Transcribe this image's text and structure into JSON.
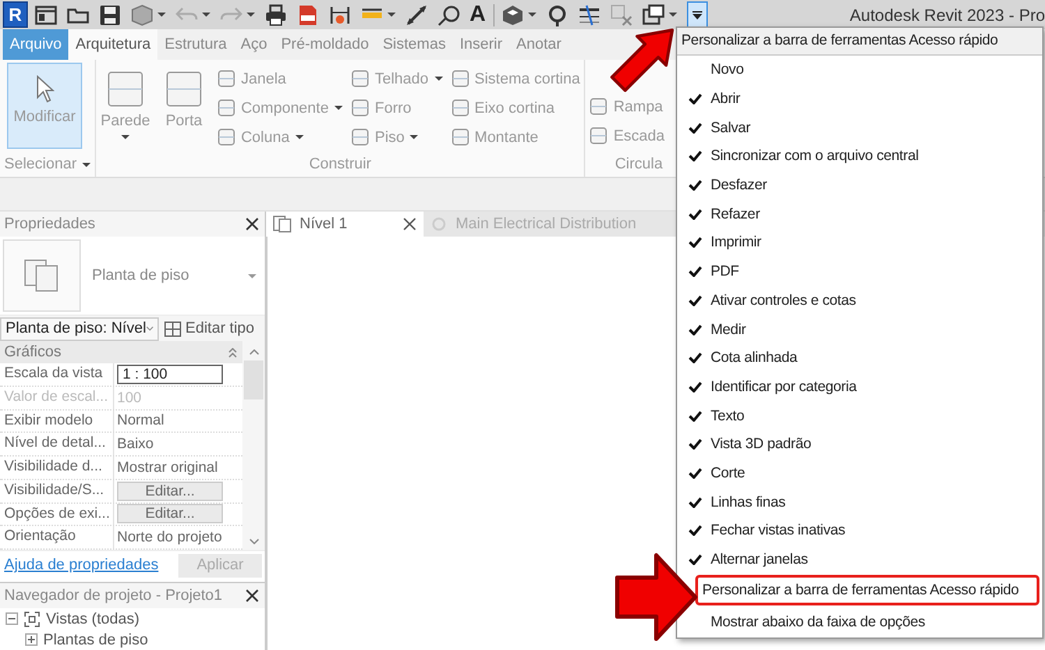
{
  "window": {
    "title": "Autodesk Revit 2023 - Pro"
  },
  "quick_access": {
    "logo": "R",
    "text_tool": "A"
  },
  "ribbon": {
    "tabs": [
      {
        "label": "Arquivo",
        "kind": "file",
        "selected": false
      },
      {
        "label": "Arquitetura",
        "kind": "tab",
        "selected": true
      },
      {
        "label": "Estrutura",
        "kind": "tab",
        "selected": false
      },
      {
        "label": "Aço",
        "kind": "tab",
        "selected": false
      },
      {
        "label": "Pré-moldado",
        "kind": "tab",
        "selected": false
      },
      {
        "label": "Sistemas",
        "kind": "tab",
        "selected": false
      },
      {
        "label": "Inserir",
        "kind": "tab",
        "selected": false
      },
      {
        "label": "Anotar",
        "kind": "tab",
        "selected": false
      }
    ],
    "panels": [
      {
        "label": "Selecionar",
        "dropdown": true,
        "tools": [
          {
            "kind": "large",
            "label": "Modificar",
            "selected": true,
            "dropdown": false
          }
        ]
      },
      {
        "label": "Construir",
        "dropdown": false,
        "tools": [
          {
            "kind": "large",
            "label": "Parede",
            "selected": false,
            "dropdown": true
          },
          {
            "kind": "large",
            "label": "Porta",
            "selected": false,
            "dropdown": false
          },
          {
            "kind": "stack",
            "items": [
              {
                "label": "Janela",
                "dropdown": false
              },
              {
                "label": "Componente",
                "dropdown": true
              },
              {
                "label": "Coluna",
                "dropdown": true
              }
            ]
          },
          {
            "kind": "stack",
            "items": [
              {
                "label": "Telhado",
                "dropdown": true
              },
              {
                "label": "Forro",
                "dropdown": false
              },
              {
                "label": "Piso",
                "dropdown": true
              }
            ]
          },
          {
            "kind": "stack",
            "items": [
              {
                "label": "Sistema cortina",
                "dropdown": false
              },
              {
                "label": "Eixo cortina",
                "dropdown": false
              },
              {
                "label": "Montante",
                "dropdown": false
              }
            ]
          }
        ]
      },
      {
        "label": "Circula",
        "dropdown": false,
        "tools": [
          {
            "kind": "stack",
            "items": [
              {
                "label": "Rampa",
                "dropdown": false
              },
              {
                "label": "Escada",
                "dropdown": false
              }
            ]
          }
        ]
      }
    ]
  },
  "properties": {
    "title": "Propriedades",
    "type_name": "Planta de piso",
    "instance_selector": "Planta de piso: Nível",
    "edit_type": "Editar tipo",
    "group": "Gráficos",
    "rows": [
      {
        "label": "Escala da vista",
        "value": "1 : 100",
        "kind": "field",
        "disabled": false
      },
      {
        "label": "Valor de escal...",
        "value": "100",
        "kind": "text",
        "disabled": true
      },
      {
        "label": "Exibir modelo",
        "value": "Normal",
        "kind": "text",
        "disabled": false
      },
      {
        "label": "Nível de detal...",
        "value": "Baixo",
        "kind": "text",
        "disabled": false
      },
      {
        "label": "Visibilidade d...",
        "value": "Mostrar original",
        "kind": "text",
        "disabled": false
      },
      {
        "label": "Visibilidade/S...",
        "value": "Editar...",
        "kind": "button",
        "disabled": false
      },
      {
        "label": "Opções de exi...",
        "value": "Editar...",
        "kind": "button",
        "disabled": false
      },
      {
        "label": "Orientação",
        "value": "Norte do projeto",
        "kind": "text",
        "disabled": false
      }
    ],
    "help_link": "Ajuda de propriedades",
    "apply_button": {
      "label": "Aplicar",
      "disabled": true
    }
  },
  "project_browser": {
    "title": "Navegador de projeto - Projeto1",
    "tree": [
      {
        "label": "Vistas (todas)",
        "expanded": true,
        "children": [
          {
            "label": "Plantas de piso",
            "expanded": false
          }
        ]
      }
    ]
  },
  "view_tabs": [
    {
      "label": "Nível 1",
      "selected": true
    },
    {
      "label": "Main Electrical Distribution",
      "selected": false
    }
  ],
  "menu": {
    "title": "Personalizar a barra de ferramentas Acesso rápido",
    "items": [
      {
        "label": "Novo",
        "checked": false,
        "selected": false
      },
      {
        "label": "Abrir",
        "checked": true,
        "selected": false
      },
      {
        "label": "Salvar",
        "checked": true,
        "selected": false
      },
      {
        "label": "Sincronizar com o arquivo central",
        "checked": true,
        "selected": false
      },
      {
        "label": "Desfazer",
        "checked": true,
        "selected": false
      },
      {
        "label": "Refazer",
        "checked": true,
        "selected": false
      },
      {
        "label": "Imprimir",
        "checked": true,
        "selected": false
      },
      {
        "label": "PDF",
        "checked": true,
        "selected": false
      },
      {
        "label": "Ativar controles e cotas",
        "checked": true,
        "selected": false
      },
      {
        "label": "Medir",
        "checked": true,
        "selected": false
      },
      {
        "label": "Cota alinhada",
        "checked": true,
        "selected": false
      },
      {
        "label": "Identificar por categoria",
        "checked": true,
        "selected": false
      },
      {
        "label": "Texto",
        "checked": true,
        "selected": false
      },
      {
        "label": "Vista 3D padrão",
        "checked": true,
        "selected": false
      },
      {
        "label": "Corte",
        "checked": true,
        "selected": false
      },
      {
        "label": "Linhas finas",
        "checked": true,
        "selected": false
      },
      {
        "label": "Fechar vistas inativas",
        "checked": true,
        "selected": false
      },
      {
        "label": "Alternar janelas",
        "checked": true,
        "selected": false
      },
      {
        "label": "Personalizar a barra de ferramentas Acesso rápido",
        "checked": false,
        "selected": true
      },
      {
        "label": "Mostrar abaixo da faixa de opções",
        "checked": false,
        "selected": false
      }
    ]
  }
}
